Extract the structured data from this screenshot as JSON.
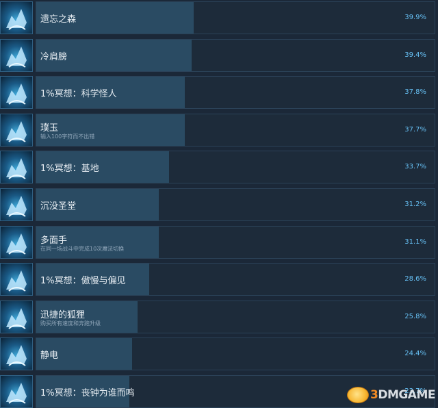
{
  "achievements": [
    {
      "title": "遗忘之森",
      "desc": "",
      "percent": "39.9%",
      "fill": 0.399,
      "icon": "wolf-forest-icon"
    },
    {
      "title": "冷肩膀",
      "desc": "",
      "percent": "39.4%",
      "fill": 0.394,
      "icon": "cold-shoulder-icon"
    },
    {
      "title": "1%冥想：科学怪人",
      "desc": "",
      "percent": "37.8%",
      "fill": 0.378,
      "icon": "lightning-tower-icon"
    },
    {
      "title": "璞玉",
      "desc": "输入100字符而不出错",
      "percent": "37.7%",
      "fill": 0.377,
      "icon": "quill-icon"
    },
    {
      "title": "1%冥想：基地",
      "desc": "",
      "percent": "33.7%",
      "fill": 0.337,
      "icon": "spiral-pillar-icon"
    },
    {
      "title": "沉没圣堂",
      "desc": "",
      "percent": "31.2%",
      "fill": 0.312,
      "icon": "sunken-temple-icon"
    },
    {
      "title": "多面手",
      "desc": "在同一场战斗中完成10次魔法切换",
      "percent": "31.1%",
      "fill": 0.311,
      "icon": "multi-arm-icon"
    },
    {
      "title": "1%冥想：傲慢与偏见",
      "desc": "",
      "percent": "28.6%",
      "fill": 0.286,
      "icon": "feather-swirl-icon"
    },
    {
      "title": "迅捷的狐狸",
      "desc": "购买所有速度和奔跑升级",
      "percent": "25.8%",
      "fill": 0.258,
      "icon": "fox-icon"
    },
    {
      "title": "静电",
      "desc": "",
      "percent": "24.4%",
      "fill": 0.244,
      "icon": "static-creature-icon"
    },
    {
      "title": "1%冥想：丧钟为谁而鸣",
      "desc": "",
      "percent": "23.7%",
      "fill": 0.237,
      "icon": "bell-tolls-icon"
    }
  ],
  "watermark": {
    "prefix": "3",
    "rest": "DMGAME"
  }
}
